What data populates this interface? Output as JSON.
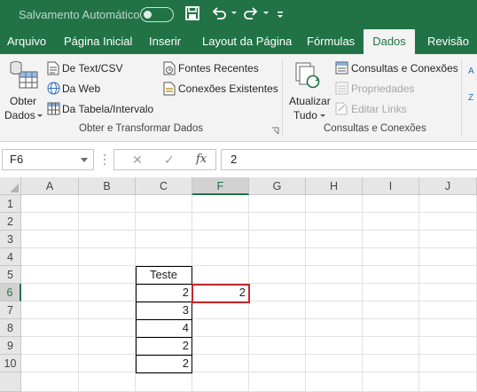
{
  "titlebar": {
    "autosave_label": "Salvamento Automático",
    "autosave_state": "off",
    "quick_access": [
      {
        "name": "save-icon"
      },
      {
        "name": "undo-icon"
      },
      {
        "name": "redo-icon"
      },
      {
        "name": "customize-qat-icon"
      }
    ]
  },
  "tabs": [
    {
      "label": "Arquivo",
      "active": false
    },
    {
      "label": "Página Inicial",
      "active": false
    },
    {
      "label": "Inserir",
      "active": false
    },
    {
      "label": "Layout da Página",
      "active": false
    },
    {
      "label": "Fórmulas",
      "active": false
    },
    {
      "label": "Dados",
      "active": true
    },
    {
      "label": "Revisão",
      "active": false
    }
  ],
  "ribbon": {
    "get_data": {
      "line1": "Obter",
      "line2": "Dados"
    },
    "from_text_csv": "De Text/CSV",
    "from_web": "Da Web",
    "from_table": "Da Tabela/Intervalo",
    "recent_sources": "Fontes Recentes",
    "existing_connections": "Conexões Existentes",
    "group1_label": "Obter e Transformar Dados",
    "refresh_all": {
      "line1": "Atualizar",
      "line2": "Tudo"
    },
    "queries_connections": "Consultas e Conexões",
    "properties": "Propriedades",
    "edit_links": "Editar Links",
    "group2_label": "Consultas e Conexões",
    "partial_edge": [
      "A",
      "Z"
    ]
  },
  "formula_bar": {
    "name_box": "F6",
    "fx_label": "fx",
    "cancel_symbol": "✕",
    "enter_symbol": "✓",
    "value": "2"
  },
  "grid": {
    "columns": [
      "A",
      "B",
      "C",
      "F",
      "G",
      "H",
      "I",
      "J"
    ],
    "selected_column": "F",
    "rows": [
      "1",
      "2",
      "3",
      "4",
      "5",
      "6",
      "7",
      "8",
      "9",
      "10"
    ],
    "selected_row": "6",
    "cells": {
      "C5": "Teste",
      "C6": "2",
      "C7": "3",
      "C8": "4",
      "C9": "2",
      "C10": "2",
      "F6": "2"
    },
    "active_cell": "F6"
  },
  "colors": {
    "excel_green": "#217346",
    "selection_border": "#c0282d"
  }
}
